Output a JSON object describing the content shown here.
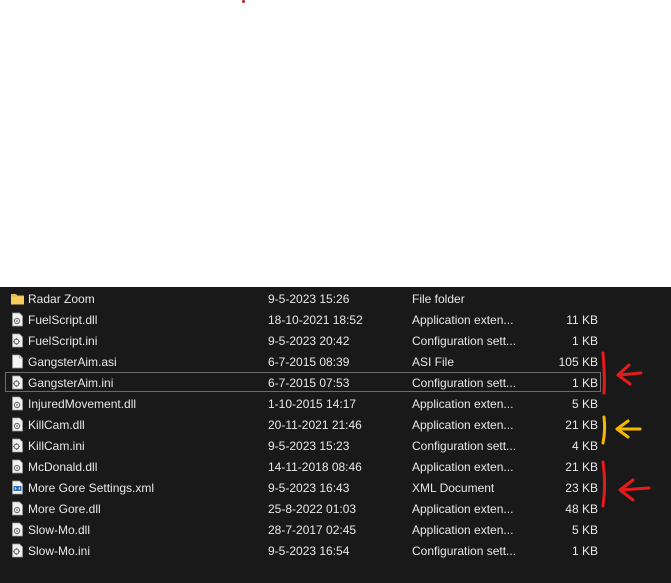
{
  "files": [
    {
      "name": "Radar Zoom",
      "date": "9-5-2023 15:26",
      "type": "File folder",
      "size": "",
      "icon": "folder-icon"
    },
    {
      "name": "FuelScript.dll",
      "date": "18-10-2021 18:52",
      "type": "Application exten...",
      "size": "11 KB",
      "icon": "dll-file-icon"
    },
    {
      "name": "FuelScript.ini",
      "date": "9-5-2023 20:42",
      "type": "Configuration sett...",
      "size": "1 KB",
      "icon": "ini-file-icon"
    },
    {
      "name": "GangsterAim.asi",
      "date": "6-7-2015 08:39",
      "type": "ASI File",
      "size": "105 KB",
      "icon": "blank-file-icon"
    },
    {
      "name": "GangsterAim.ini",
      "date": "6-7-2015 07:53",
      "type": "Configuration sett...",
      "size": "1 KB",
      "icon": "ini-file-icon"
    },
    {
      "name": "InjuredMovement.dll",
      "date": "1-10-2015 14:17",
      "type": "Application exten...",
      "size": "5 KB",
      "icon": "dll-file-icon"
    },
    {
      "name": "KillCam.dll",
      "date": "20-11-2021 21:46",
      "type": "Application exten...",
      "size": "21 KB",
      "icon": "dll-file-icon"
    },
    {
      "name": "KillCam.ini",
      "date": "9-5-2023 15:23",
      "type": "Configuration sett...",
      "size": "4 KB",
      "icon": "ini-file-icon"
    },
    {
      "name": "McDonald.dll",
      "date": "14-11-2018 08:46",
      "type": "Application exten...",
      "size": "21 KB",
      "icon": "dll-file-icon"
    },
    {
      "name": "More Gore Settings.xml",
      "date": "9-5-2023 16:43",
      "type": "XML Document",
      "size": "23 KB",
      "icon": "xml-file-icon"
    },
    {
      "name": "More Gore.dll",
      "date": "25-8-2022 01:03",
      "type": "Application exten...",
      "size": "48 KB",
      "icon": "dll-file-icon"
    },
    {
      "name": "Slow-Mo.dll",
      "date": "28-7-2017 02:45",
      "type": "Application exten...",
      "size": "5 KB",
      "icon": "dll-file-icon"
    },
    {
      "name": "Slow-Mo.ini",
      "date": "9-5-2023 16:54",
      "type": "Configuration sett...",
      "size": "1 KB",
      "icon": "ini-file-icon"
    }
  ],
  "colors": {
    "explorer_bg": "#191919",
    "text": "#e8e8e8",
    "annotation_red": "#e41b1b",
    "annotation_yellow": "#f5b800"
  }
}
